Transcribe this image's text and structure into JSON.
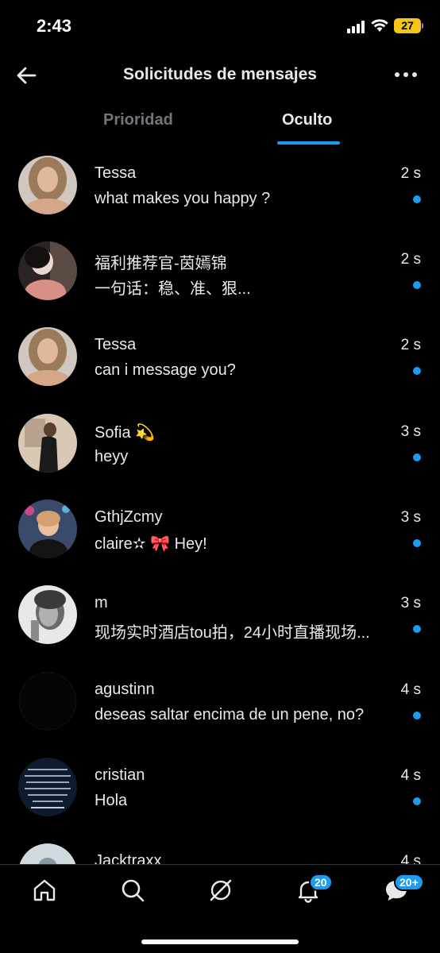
{
  "status_bar": {
    "time": "2:43",
    "battery": "27"
  },
  "header": {
    "title": "Solicitudes de mensajes",
    "back_icon": "arrow-left-icon",
    "more_icon": "more-horizontal-icon"
  },
  "tabs": [
    {
      "label": "Prioridad",
      "selected": false
    },
    {
      "label": "Oculto",
      "selected": true
    }
  ],
  "colors": {
    "accent": "#1d9bf0",
    "background": "#000000",
    "text": "#e7e9ea",
    "muted": "#71767b"
  },
  "requests": [
    {
      "name": "Tessa",
      "message": "what makes you happy ?",
      "time": "2 s",
      "unread": true
    },
    {
      "name": "福利推荐官-茵嫣锦",
      "message": "一句话：稳、准、狠...",
      "time": "2 s",
      "unread": true
    },
    {
      "name": "Tessa",
      "message": "can i message you?",
      "time": "2 s",
      "unread": true
    },
    {
      "name": "Sofia 💫",
      "message": "heyy",
      "time": "3 s",
      "unread": true
    },
    {
      "name": "GthjZcmy",
      "message": "claire✫ 🎀 Hey!",
      "time": "3 s",
      "unread": true
    },
    {
      "name": "m",
      "message": "现场实时酒店tou拍，24小时直播现场...",
      "time": "3 s",
      "unread": true
    },
    {
      "name": "agustinn",
      "message": "deseas saltar encima de un pene, no?",
      "time": "4 s",
      "unread": true
    },
    {
      "name": "cristian",
      "message": "Hola",
      "time": "4 s",
      "unread": true
    },
    {
      "name": "Jacktraxx",
      "message": "",
      "time": "4 s",
      "unread": false
    }
  ],
  "bottom_nav": {
    "items": [
      "home-icon",
      "search-icon",
      "grok-icon",
      "notifications-icon",
      "messages-icon"
    ],
    "notifications_badge": "20",
    "messages_badge": "20+"
  }
}
